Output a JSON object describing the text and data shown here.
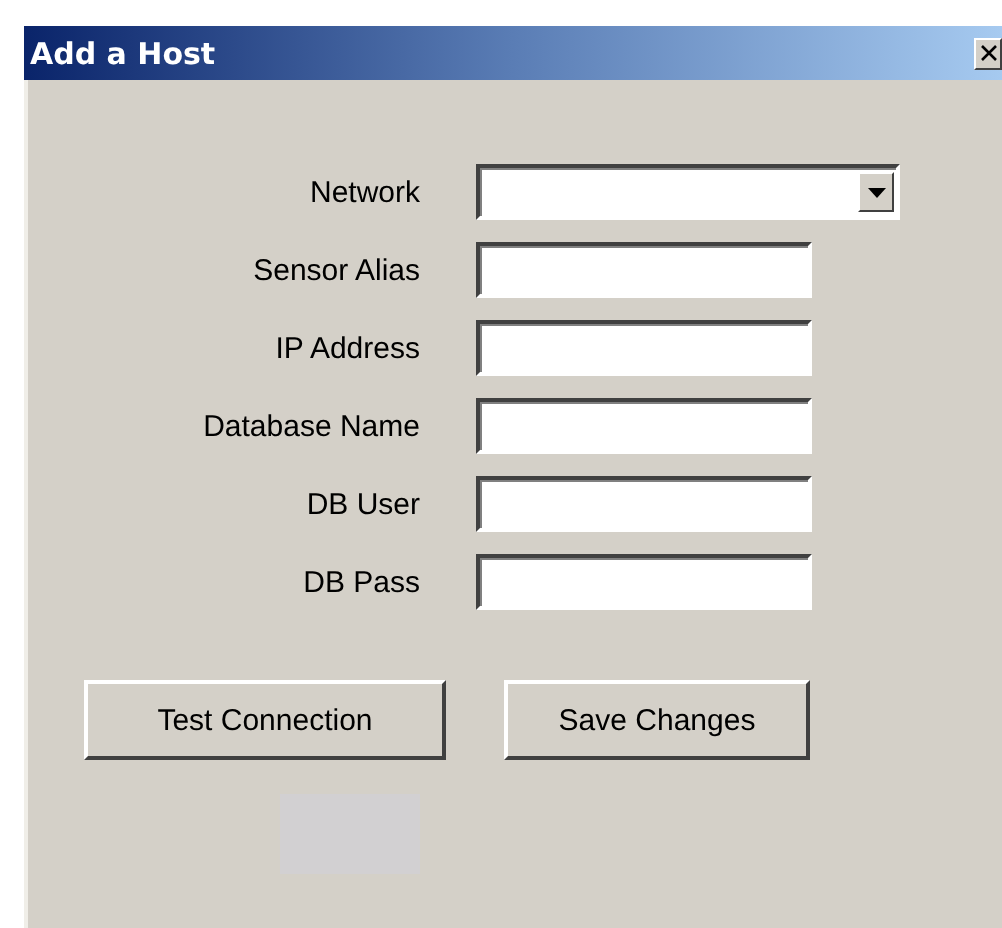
{
  "window": {
    "title": "Add a Host"
  },
  "fields": [
    {
      "label": "Network",
      "kind": "dropdown"
    },
    {
      "label": "Sensor Alias",
      "kind": "text"
    },
    {
      "label": "IP Address",
      "kind": "text"
    },
    {
      "label": "Database Name",
      "kind": "text"
    },
    {
      "label": "DB User",
      "kind": "text"
    },
    {
      "label": "DB Pass",
      "kind": "text"
    }
  ],
  "buttons": [
    "Test Connection",
    "Save Changes"
  ]
}
